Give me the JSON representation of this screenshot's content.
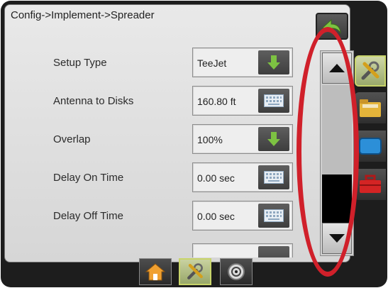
{
  "header": {
    "breadcrumb": "Config->Implement->Spreader"
  },
  "settings": [
    {
      "label": "Setup Type",
      "value": "TeeJet",
      "control": "arrow-down-icon"
    },
    {
      "label": "Antenna to Disks",
      "value": "160.80 ft",
      "control": "keyboard-icon"
    },
    {
      "label": "Overlap",
      "value": "100%",
      "control": "arrow-down-icon"
    },
    {
      "label": "Delay On Time",
      "value": "0.00 sec",
      "control": "keyboard-icon"
    },
    {
      "label": "Delay Off Time",
      "value": "0.00 sec",
      "control": "keyboard-icon"
    }
  ],
  "scrollbar": {
    "up_icon": "triangle-up-icon",
    "down_icon": "triangle-down-icon",
    "thumb_position_fraction": 0.65
  },
  "side_tabs": [
    "tools-icon",
    "folder-icon",
    "monitor-icon",
    "toolbox-icon"
  ],
  "bottom_tabs": [
    "home-icon",
    "tools-icon",
    "gauge-icon"
  ],
  "colors": {
    "accent_green": "#7dc242",
    "highlight_red": "#d0202a",
    "active_tab": "#c8d46a"
  }
}
